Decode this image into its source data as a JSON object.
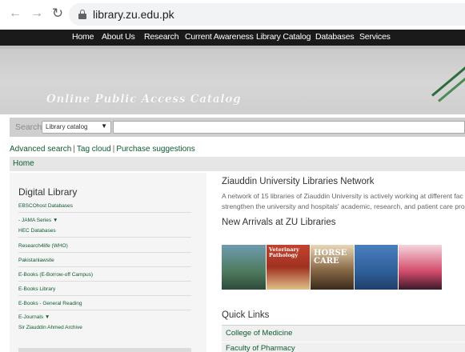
{
  "browser": {
    "url": "library.zu.edu.pk"
  },
  "topnav": {
    "items": [
      "Home",
      "About Us",
      "Research",
      "Current Awareness",
      "Library Catalog",
      "Databases",
      "Services"
    ]
  },
  "banner": {
    "title": "Online Public Access Catalog"
  },
  "search": {
    "label": "Search",
    "scope": "Library catalog",
    "value": ""
  },
  "links": {
    "advanced_search": "Advanced search",
    "tag_cloud": "Tag cloud",
    "purchase_suggestions": "Purchase suggestions",
    "separator": "|"
  },
  "breadcrumb": {
    "home": "Home"
  },
  "sidebar": {
    "title": "Digital Library",
    "items": [
      "EBSCOhost Databases",
      "- JAMA Series ▼",
      "HEC Databases",
      "Research4life (WHO)",
      "Pakistanlawsite",
      "E-Books (E-Borrow-off Campus)",
      "E-Books Library",
      "E-Books - General Reading",
      "E-Journals ▼",
      "Sir Ziauddin Ahmed Archive"
    ]
  },
  "main": {
    "network_title": "Ziauddin University Libraries Network",
    "network_text_1": "A network of 15 libraries of Ziauddin University is actively working at different fac",
    "network_text_2": "strengthen the university and hospitals' academic, research, and patient care prog",
    "new_arrivals_title": "New Arrivals at ZU Libraries",
    "covers": [
      {
        "title": "",
        "color": "#5a8a6a"
      },
      {
        "title": "Veterinary Pathology",
        "color": "#b33a2a"
      },
      {
        "title": "HORSE CARE",
        "color": "#7a5a3a"
      },
      {
        "title": "",
        "color": "#3a6fa8"
      },
      {
        "title": "",
        "color": "#d24a6a"
      }
    ],
    "quick_links_title": "Quick Links",
    "quick_links": [
      "College of Medicine",
      "Faculty of Pharmacy"
    ]
  },
  "colors": {
    "nav_bg": "#1a1a1a",
    "link_green": "#0e5b2f",
    "sidebar_bg": "#f5f5f5"
  }
}
